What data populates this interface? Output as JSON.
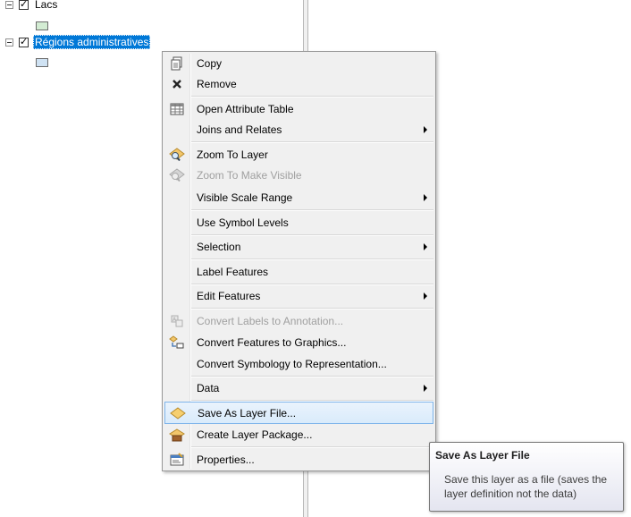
{
  "toc": {
    "layers": [
      {
        "name": "Lacs",
        "checked": true,
        "selected": false,
        "swatch_color": "#d3ecd3"
      },
      {
        "name": "Régions administratives",
        "checked": true,
        "selected": true,
        "swatch_color": "#cfe2f3"
      }
    ]
  },
  "context_menu": {
    "items": [
      {
        "label": "Copy",
        "icon": "copy-icon",
        "disabled": false,
        "submenu": false
      },
      {
        "label": "Remove",
        "icon": "remove-icon",
        "disabled": false,
        "submenu": false
      },
      {
        "label": "Open Attribute Table",
        "icon": "attribute-table-icon",
        "disabled": false,
        "submenu": false
      },
      {
        "label": "Joins and Relates",
        "icon": "",
        "disabled": false,
        "submenu": true
      },
      {
        "label": "Zoom To Layer",
        "icon": "zoom-to-layer-icon",
        "disabled": false,
        "submenu": false
      },
      {
        "label": "Zoom To Make Visible",
        "icon": "zoom-to-make-visible-icon",
        "disabled": true,
        "submenu": false
      },
      {
        "label": "Visible Scale Range",
        "icon": "",
        "disabled": false,
        "submenu": true
      },
      {
        "label": "Use Symbol Levels",
        "icon": "",
        "disabled": false,
        "submenu": false
      },
      {
        "label": "Selection",
        "icon": "",
        "disabled": false,
        "submenu": true
      },
      {
        "label": "Label Features",
        "icon": "",
        "disabled": false,
        "submenu": false
      },
      {
        "label": "Edit Features",
        "icon": "",
        "disabled": false,
        "submenu": true
      },
      {
        "label": "Convert Labels to Annotation...",
        "icon": "convert-labels-icon",
        "disabled": true,
        "submenu": false
      },
      {
        "label": "Convert Features to Graphics...",
        "icon": "convert-features-icon",
        "disabled": false,
        "submenu": false
      },
      {
        "label": "Convert Symbology to Representation...",
        "icon": "",
        "disabled": false,
        "submenu": false
      },
      {
        "label": "Data",
        "icon": "",
        "disabled": false,
        "submenu": true
      },
      {
        "label": "Save As Layer File...",
        "icon": "save-layer-file-icon",
        "disabled": false,
        "submenu": false,
        "hovered": true
      },
      {
        "label": "Create Layer Package...",
        "icon": "layer-package-icon",
        "disabled": false,
        "submenu": false
      },
      {
        "label": "Properties...",
        "icon": "properties-icon",
        "disabled": false,
        "submenu": false
      }
    ]
  },
  "tooltip": {
    "title": "Save As Layer File",
    "body": "Save this layer as a file (saves the layer definition not the data)"
  }
}
